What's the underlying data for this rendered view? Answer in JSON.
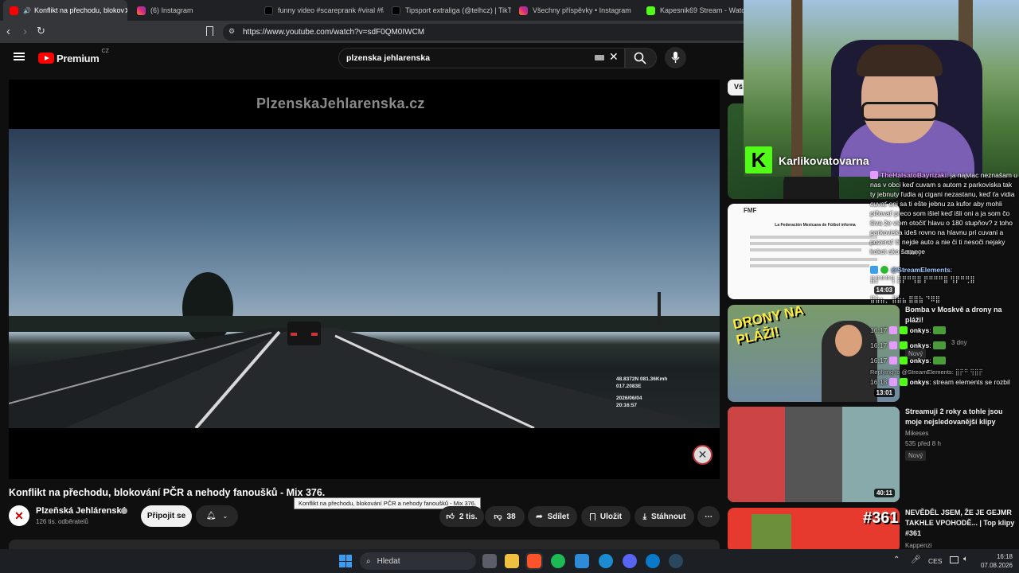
{
  "browser": {
    "tabs": [
      {
        "label": "Konflikt na přechodu, blokov",
        "active": true,
        "icon_color": "#ff0000"
      },
      {
        "label": "(6) Instagram",
        "icon_color": "#e1306c"
      },
      {
        "label": "funny video #scareprank #viral #fai",
        "icon_color": "#ffffff"
      },
      {
        "label": "Tipsport extraliga (@telhcz) | TikTok",
        "icon_color": "#ffffff"
      },
      {
        "label": "Všechny příspěvky • Instagram",
        "icon_color": "#e1306c"
      },
      {
        "label": "Kapesnik69 Stream - Watch",
        "icon_color": "#53fc18"
      }
    ],
    "url": "https://www.youtube.com/watch?v=sdF0QM0IWCM"
  },
  "youtube": {
    "logo": "Premium",
    "logo_sup": "CZ",
    "search_value": "plzenska jehlarenska",
    "video_banner": "PlzenskaJehlarenska.cz",
    "overlay": {
      "gps": "48.8372N 081.36Kmh",
      "gps2": "017.2083E",
      "date": "2026/06/04",
      "time": "20:16:57"
    },
    "video_title": "Konflikt na přechodu, blokování PČR a nehody fanoušků - Mix 376.",
    "tooltip": "Konflikt na přechodu, blokování PČR a nehody fanoušků - Mix 376.",
    "channel_name": "Plzeňská Jehlárenská",
    "subscribers": "126 tis. odběratelů",
    "subscribe_label": "Připojit se",
    "likes": "2 tis.",
    "dislikes": "38",
    "share_label": "Sdílet",
    "save_label": "Uložit",
    "download_label": "Stáhnout",
    "chip_partial": "Vš",
    "recommended": [
      {
        "thumb_text": "",
        "duration": "",
        "title": "",
        "meta": ""
      },
      {
        "thumb_text": "La Federación Mexicana de Fútbol informa",
        "duration": "14:03",
        "title": "",
        "meta": "Nový"
      },
      {
        "thumb_text": "DRONY NA PLÁŽI!",
        "duration": "13:01",
        "title": "Bomba v Moskvě a drony na pláži!",
        "meta": "3 dny",
        "badge": "Nový"
      },
      {
        "thumb_text": "",
        "duration": "40:11",
        "title": "Streamuji 2 roky a tohle jsou moje nejsledovanější klipy",
        "channel": "Mikeses",
        "meta": "535  před 8 h",
        "badge": "Nový"
      },
      {
        "thumb_text": "#361",
        "duration": "",
        "title": "NEVĚDĚL JSEM, ŽE JE GEJMR TAKHLE VPOHODĚ... | Top klipy #361",
        "channel": "Kappenzi",
        "meta": ""
      }
    ]
  },
  "stream": {
    "streamer_name": "Karlikovatovarna",
    "chat": [
      {
        "user": "TheHalsatoBayrizaki",
        "text": "ja najviac neznašam u nas v obci keď cuvam s autom z parkoviska tak ty jebnuty ľudia aj cigani nezastanu, keď ťa vidia cuvať oni sa ti ešte jebnu za kufor aby mohli pičovať preco som išiel keď išli oni a ja som čo šiva že viem otočiť hlavu o 180 stupňov? z toho parkoviska ideš rovno na hlavnu pri cuvani a pozerať či nejde auto a nie či ti nesoči nejaky kokot ako šarance"
      },
      {
        "user": "@StreamElements",
        "text": "⣿⡟⠛⠛⢻ ⣿⡟⠛⢻⣿ ⡟⠛⠛⠛⣿ ⢻⡟⠛⢛⣿"
      },
      {
        "user": "",
        "text": "⣿⣷⣦⡀ ⣿⣷⣦ ⣿⣿⣷ ⠙⠿⣿"
      },
      {
        "user": "onkys",
        "text": "",
        "time": "16:17"
      },
      {
        "user": "onkys",
        "text": "",
        "time": "16:17"
      },
      {
        "user": "onkys",
        "text": "",
        "time": "16:17"
      },
      {
        "user": "Replying to @StreamElements",
        "text": "⣿⡟⠛ ⢻⣿⡟",
        "time": ""
      },
      {
        "user": "onkys",
        "text": "stream elements se rozbil",
        "time": "16:18"
      }
    ]
  },
  "taskbar": {
    "search_placeholder": "Hledat",
    "lang": "CES",
    "time": "16:18",
    "date": "07.08.2026"
  },
  "colors": {
    "yt_red": "#ff0000",
    "kick_green": "#53fc18",
    "chat_name": "#e59bff"
  }
}
